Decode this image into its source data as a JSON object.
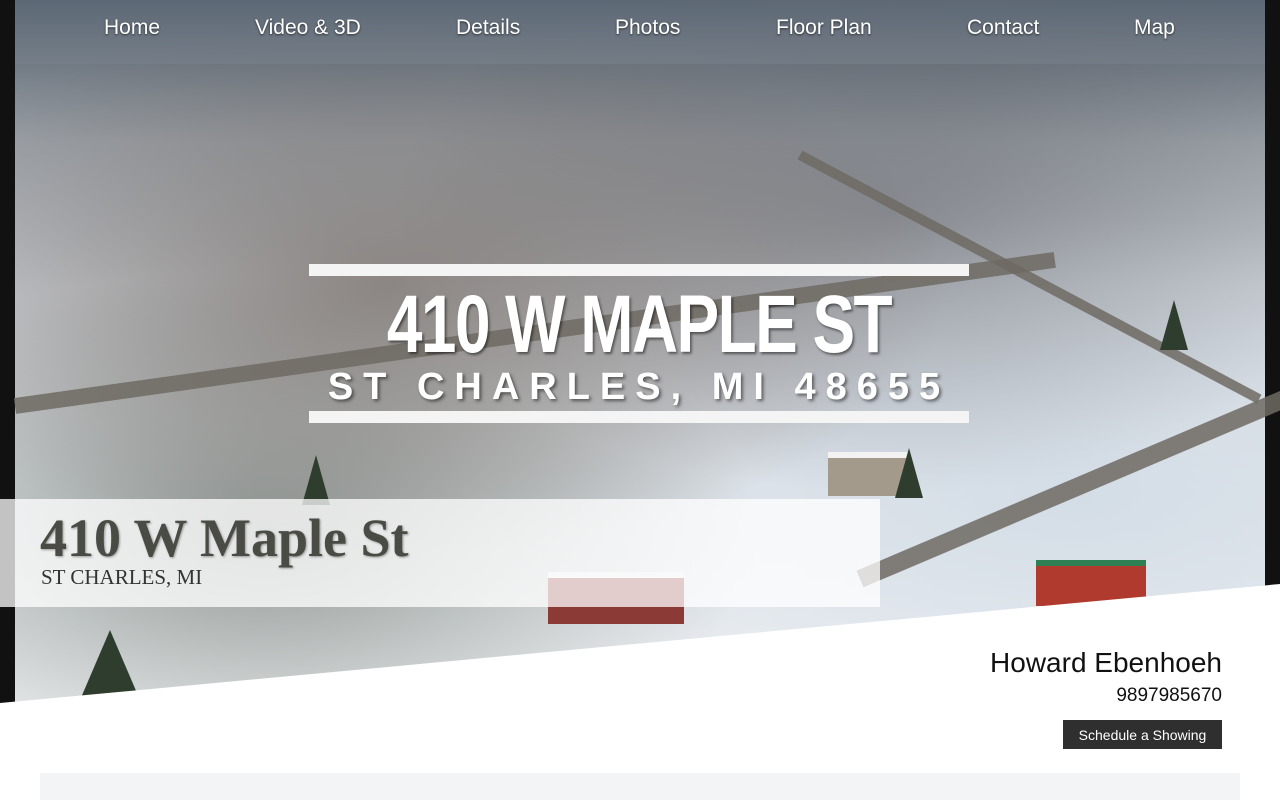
{
  "nav": {
    "items": [
      {
        "label": "Home"
      },
      {
        "label": "Video & 3D"
      },
      {
        "label": "Details"
      },
      {
        "label": "Photos"
      },
      {
        "label": "Floor Plan"
      },
      {
        "label": "Contact"
      },
      {
        "label": "Map"
      }
    ]
  },
  "hero": {
    "banner_title": "410 W MAPLE ST",
    "banner_subtitle": "ST CHARLES, MI 48655"
  },
  "address": {
    "street": "410 W Maple St",
    "city": "ST CHARLES, MI"
  },
  "agent": {
    "name": "Howard Ebenhoeh",
    "phone": "9897985670",
    "schedule_label": "Schedule a Showing"
  },
  "colors": {
    "nav_overlay": "#78828c",
    "button_bg": "#2f2f2f",
    "panel_bg": "#f3f4f6"
  }
}
